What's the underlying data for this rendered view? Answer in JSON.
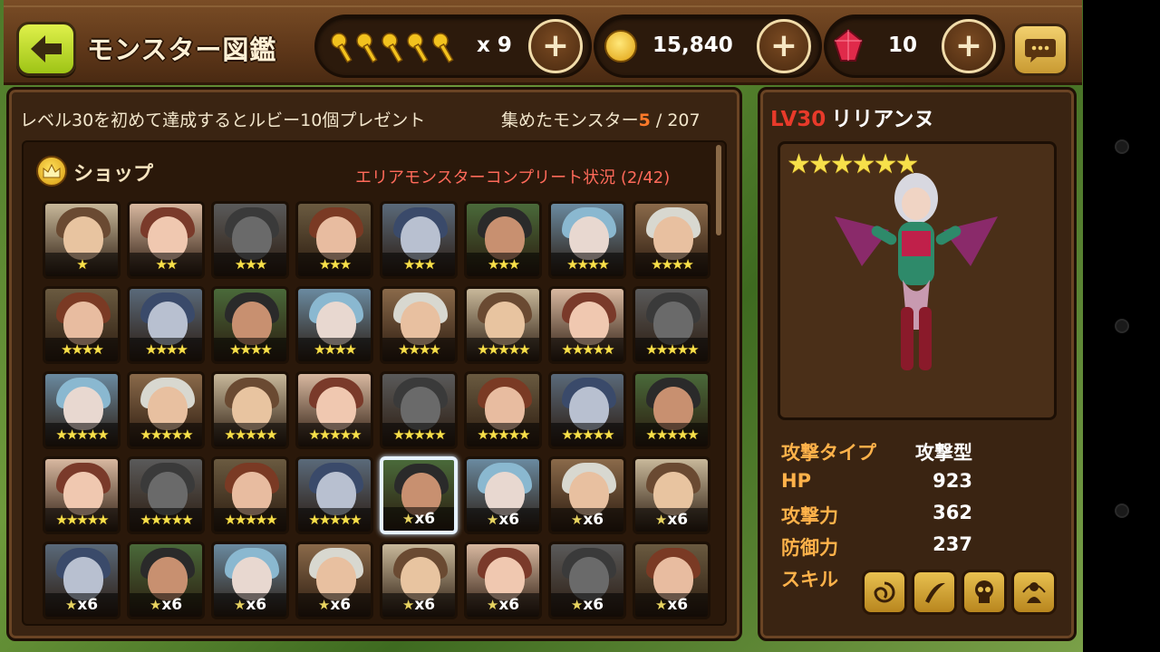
{
  "header": {
    "title": "モンスター図鑑",
    "keys": {
      "count": "x 9"
    },
    "gold": {
      "value": "15,840"
    },
    "ruby": {
      "value": "10"
    }
  },
  "collection": {
    "hint": "レベル30を初めて達成するとルビー10個プレゼント",
    "collected_label": "集めたモンスター",
    "collected_count": "5",
    "collected_total": " / 207",
    "shop_label": "ショップ",
    "area_status": "エリアモンスターコンプリート状況 (2/42)"
  },
  "grid": {
    "rows": [
      [
        {
          "stars": "★"
        },
        {
          "stars": "★★"
        },
        {
          "stars": "★★★"
        },
        {
          "stars": "★★★"
        },
        {
          "stars": "★★★"
        },
        {
          "stars": "★★★"
        },
        {
          "stars": "★★★★"
        },
        {
          "stars": "★★★★"
        }
      ],
      [
        {
          "stars": "★★★★"
        },
        {
          "stars": "★★★★"
        },
        {
          "stars": "★★★★"
        },
        {
          "stars": "★★★★"
        },
        {
          "stars": "★★★★"
        },
        {
          "stars": "★★★★★"
        },
        {
          "stars": "★★★★★"
        },
        {
          "stars": "★★★★★"
        }
      ],
      [
        {
          "stars": "★★★★★"
        },
        {
          "stars": "★★★★★"
        },
        {
          "stars": "★★★★★"
        },
        {
          "stars": "★★★★★"
        },
        {
          "stars": "★★★★★"
        },
        {
          "stars": "★★★★★"
        },
        {
          "stars": "★★★★★"
        },
        {
          "stars": "★★★★★"
        }
      ],
      [
        {
          "stars": "★★★★★"
        },
        {
          "stars": "★★★★★"
        },
        {
          "stars": "★★★★★"
        },
        {
          "stars": "★★★★★"
        },
        {
          "x": "x6"
        },
        {
          "x": "x6"
        },
        {
          "x": "x6"
        },
        {
          "x": "x6"
        }
      ],
      [
        {
          "x": "x6"
        },
        {
          "x": "x6"
        },
        {
          "x": "x6"
        },
        {
          "x": "x6"
        },
        {
          "x": "x6"
        },
        {
          "x": "x6"
        },
        {
          "x": "x6"
        },
        {
          "x": "x6"
        }
      ]
    ]
  },
  "detail": {
    "level": "LV30",
    "name": "リリアンヌ",
    "stars": "★★★★★★",
    "attack_type_label": "攻撃タイプ",
    "attack_type_value": "攻撃型",
    "hp_label": "HP",
    "hp_value": "923",
    "atk_label": "攻撃力",
    "atk_value": "362",
    "def_label": "防御力",
    "def_value": "237",
    "skill_label": "スキル"
  }
}
